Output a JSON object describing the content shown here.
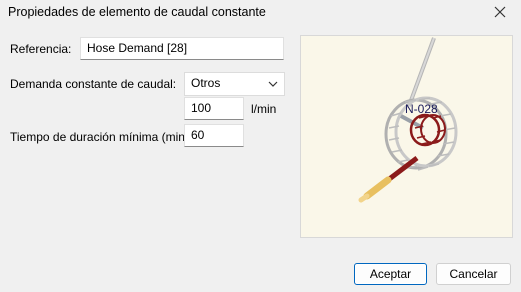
{
  "window": {
    "title": "Propiedades de elemento de caudal constante"
  },
  "form": {
    "referencia_label": "Referencia:",
    "referencia_value": "Hose Demand [28]",
    "demanda_label": "Demanda constante de caudal:",
    "demanda_select": "Otros",
    "caudal_value": "100",
    "caudal_unit": "l/min",
    "tiempo_label": "Tiempo de duración mínima (min):",
    "tiempo_value": "60"
  },
  "preview": {
    "node_label": "N-028"
  },
  "buttons": {
    "aceptar": "Aceptar",
    "cancelar": "Cancelar"
  },
  "colors": {
    "accent": "#0067c0",
    "hose_red": "#8b1a1a",
    "preview_bg": "#faf7e9"
  }
}
